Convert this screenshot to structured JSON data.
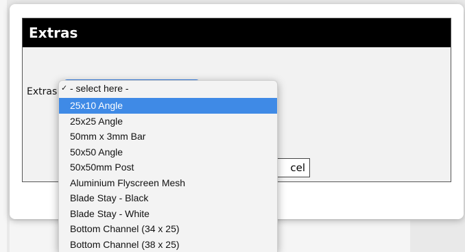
{
  "panel": {
    "title": "Extras"
  },
  "form": {
    "extras_label": "Extras"
  },
  "dropdown": {
    "selected_check": "✓",
    "options": [
      "- select here -",
      "25x10 Angle",
      "25x25 Angle",
      "50mm x 3mm Bar",
      "50x50 Angle",
      "50x50mm Post",
      "Aluminium Flyscreen Mesh",
      "Blade Stay - Black",
      "Blade Stay - White",
      "Bottom Channel (34 x 25)",
      "Bottom Channel (38 x 25)"
    ]
  },
  "cancel_button": {
    "label_visible": "cel"
  },
  "colors": {
    "header": "#000000",
    "highlight": "#3f8ae6",
    "select_border": "#2f7ae5"
  }
}
